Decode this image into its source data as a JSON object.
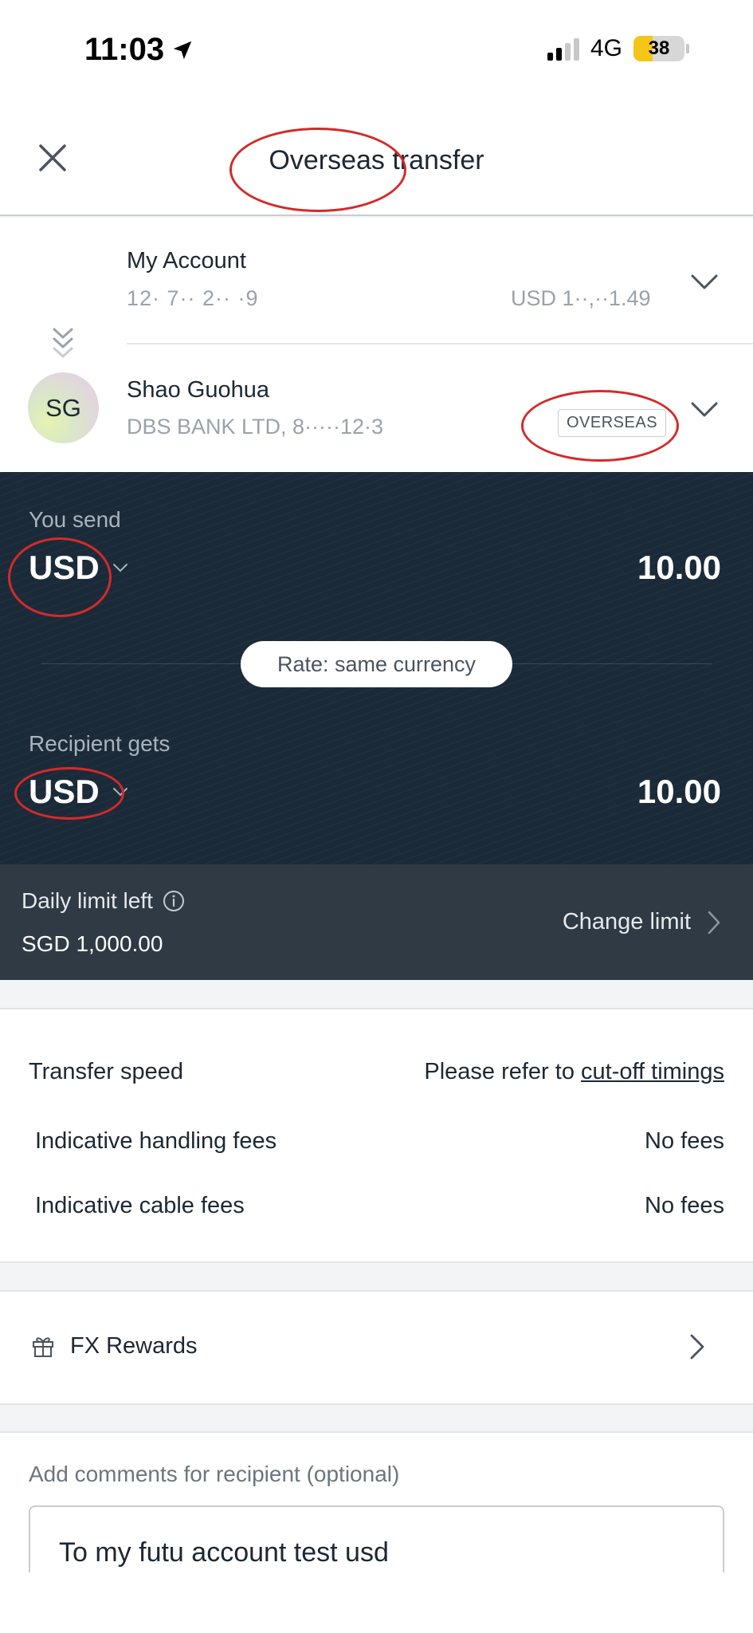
{
  "status_bar": {
    "time": "11:03",
    "network": "4G",
    "battery": "38",
    "battery_fraction": 0.38
  },
  "header": {
    "title": "Overseas transfer"
  },
  "from_account": {
    "label": "My Account",
    "number_masked": "12· 7·· 2·· ·9",
    "balance_masked": "USD 1··,··1.49"
  },
  "to_account": {
    "initials": "SG",
    "name": "Shao Guohua",
    "bank_masked": "DBS BANK LTD, 8·····12·3",
    "badge": "OVERSEAS"
  },
  "send": {
    "label": "You send",
    "currency": "USD",
    "amount": "10.00"
  },
  "rate": {
    "text": "Rate: same currency"
  },
  "receive": {
    "label": "Recipient gets",
    "currency": "USD",
    "amount": "10.00"
  },
  "limit": {
    "label": "Daily limit left",
    "value": "SGD 1,000.00",
    "change_label": "Change limit"
  },
  "fees": {
    "speed_label": "Transfer speed",
    "speed_prefix": "Please refer to ",
    "speed_link": "cut-off timings",
    "handling_label": "Indicative handling fees",
    "handling_value": "No fees",
    "cable_label": "Indicative cable fees",
    "cable_value": "No fees"
  },
  "fx_rewards": {
    "label": "FX Rewards"
  },
  "comments": {
    "label": "Add comments for recipient (optional)",
    "value": "To my futu account test usd"
  },
  "colors": {
    "panel_bg": "#1b2a38",
    "limit_bg": "#2f3a44",
    "annotation_red": "#d42a2a",
    "battery_yellow": "#f5c518"
  },
  "icons": [
    "location-arrow-icon",
    "signal-icon",
    "battery-icon",
    "close-icon",
    "chevron-down-icon",
    "swap-arrows-icon",
    "info-icon",
    "chevron-right-icon",
    "gift-icon"
  ]
}
